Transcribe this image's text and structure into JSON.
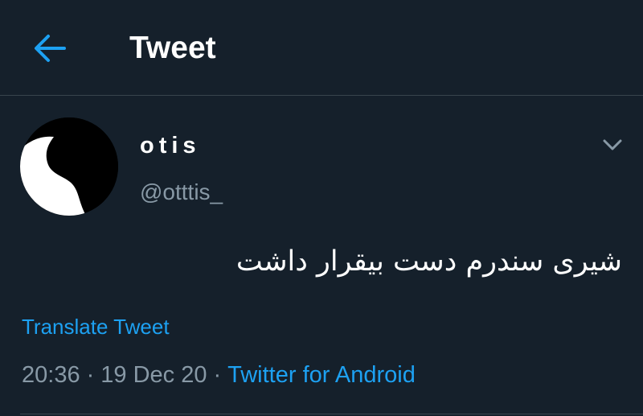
{
  "header": {
    "back_icon": "arrow-left-icon",
    "title": "Tweet"
  },
  "tweet": {
    "author": {
      "display_name": "otis",
      "handle": "@otttis_",
      "avatar_icon": "profile-avatar"
    },
    "more_icon": "chevron-down-icon",
    "text": "شیری سندرم دست بیقرار داشت",
    "translate_label": "Translate Tweet",
    "time": "20:36",
    "date": "19 Dec 20",
    "source": "Twitter for Android",
    "separator": "·"
  },
  "colors": {
    "background": "#15202b",
    "accent": "#1da1f2",
    "secondary_text": "#8899a6",
    "divider": "#38444d"
  }
}
